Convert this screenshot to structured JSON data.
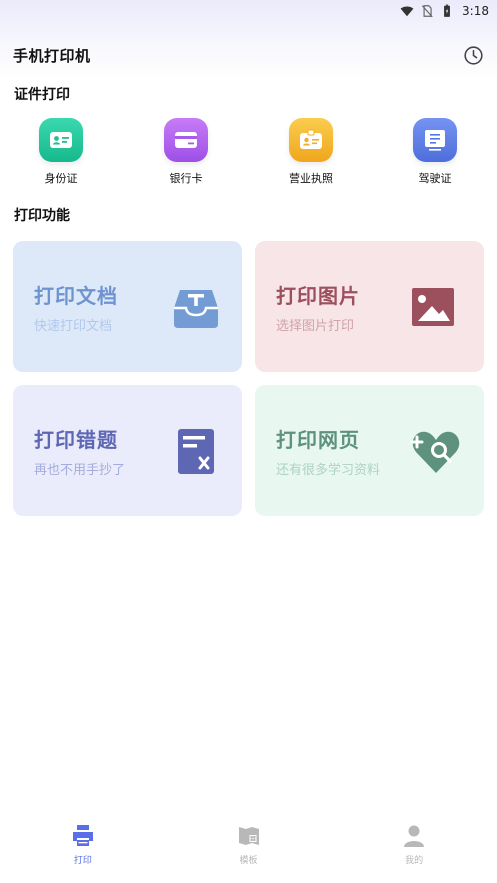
{
  "status_bar": {
    "time": "3:18"
  },
  "header": {
    "title": "手机打印机"
  },
  "id_section": {
    "title": "证件打印",
    "items": [
      {
        "label": "身份证",
        "color": "#22c69c"
      },
      {
        "label": "银行卡",
        "color": "#b562ee"
      },
      {
        "label": "营业执照",
        "color": "#f5b630"
      },
      {
        "label": "驾驶证",
        "color": "#5a7fe6"
      }
    ]
  },
  "feature_section": {
    "title": "打印功能",
    "cards": [
      {
        "title": "打印文档",
        "subtitle": "快速打印文档",
        "bg": "#dde8f9",
        "title_color": "#6e94cf",
        "sub_color": "#b2c8ea",
        "icon_color": "#6e98d2"
      },
      {
        "title": "打印图片",
        "subtitle": "选择图片打印",
        "bg": "#f7e5e7",
        "title_color": "#9c4f5c",
        "sub_color": "#d0a3aa",
        "icon_color": "#9c4f5c"
      },
      {
        "title": "打印错题",
        "subtitle": "再也不用手抄了",
        "bg": "#eaecfb",
        "title_color": "#5e67b3",
        "sub_color": "#a5abdc",
        "icon_color": "#5e67b3"
      },
      {
        "title": "打印网页",
        "subtitle": "还有很多学习资料",
        "bg": "#e8f7f0",
        "title_color": "#5e927f",
        "sub_color": "#aed3c3",
        "icon_color": "#5e927f"
      }
    ]
  },
  "bottom_nav": {
    "items": [
      {
        "label": "打印",
        "active": true
      },
      {
        "label": "模板",
        "active": false
      },
      {
        "label": "我的",
        "active": false
      }
    ],
    "active_color": "#5a6ee8",
    "inactive_color": "#b8b8b8"
  }
}
